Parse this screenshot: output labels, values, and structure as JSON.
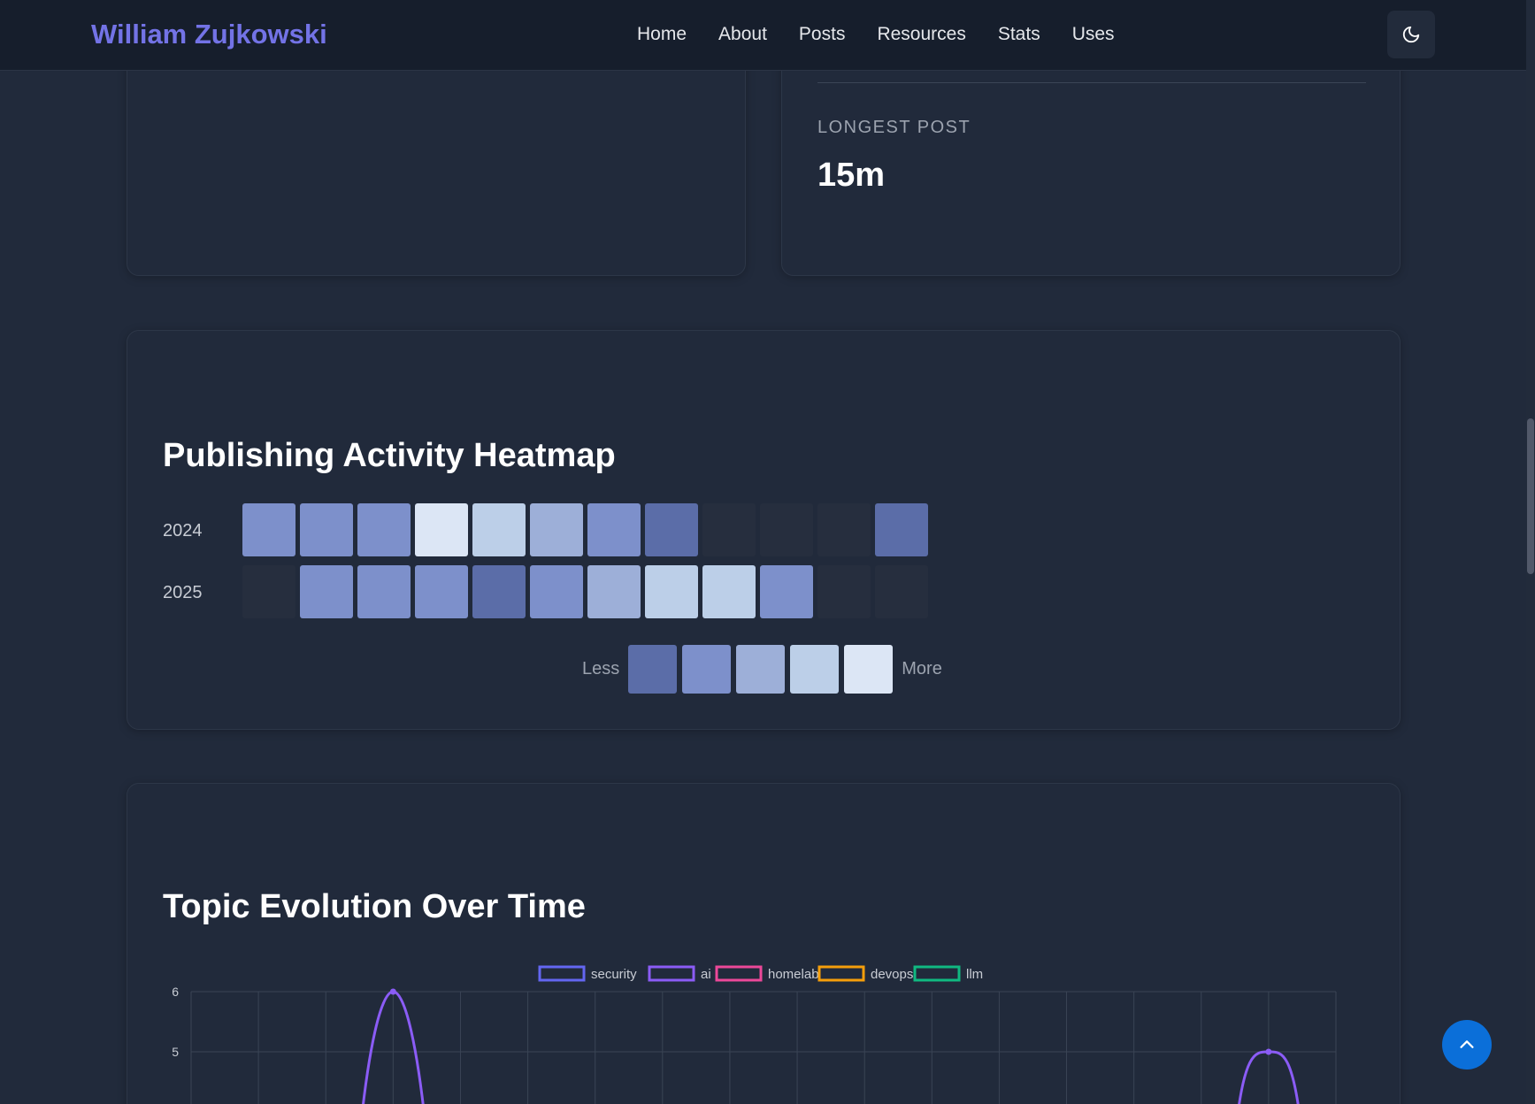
{
  "header": {
    "brand": "William Zujkowski",
    "nav": [
      "Home",
      "About",
      "Posts",
      "Resources",
      "Stats",
      "Uses"
    ],
    "theme_toggle_icon": "moon-icon"
  },
  "stats": {
    "longest_post_label": "LONGEST POST",
    "longest_post_value": "15m"
  },
  "heatmap": {
    "title": "Publishing Activity Heatmap",
    "rows": [
      {
        "year": "2024",
        "levels": [
          2,
          2,
          2,
          5,
          4,
          3,
          2,
          1,
          0,
          0,
          0,
          1
        ]
      },
      {
        "year": "2025",
        "levels": [
          0,
          2,
          2,
          2,
          1,
          2,
          3,
          4,
          4,
          2,
          0,
          0
        ]
      }
    ],
    "legend_less": "Less",
    "legend_more": "More",
    "level_colors": [
      "#262e3e",
      "#5b6da8",
      "#7d90cb",
      "#9dafd8",
      "#bccfe8",
      "#dce6f5"
    ]
  },
  "topic": {
    "title": "Topic Evolution Over Time"
  },
  "chart_data": {
    "type": "line",
    "title": "Topic Evolution Over Time",
    "series": [
      {
        "name": "security",
        "color": "#6366f1"
      },
      {
        "name": "ai",
        "color": "#8b5cf6"
      },
      {
        "name": "homelab",
        "color": "#ec4899"
      },
      {
        "name": "devops",
        "color": "#f59e0b"
      },
      {
        "name": "llm",
        "color": "#10b981"
      }
    ],
    "y_ticks_visible": [
      6,
      5
    ],
    "visible_peaks": [
      {
        "series": "ai",
        "x_index": 3,
        "y": 6
      },
      {
        "series": "ai",
        "x_index": 16,
        "y": 5
      }
    ],
    "grid": true,
    "legend_position": "top-center"
  },
  "back_to_top_icon": "chevron-up-icon"
}
